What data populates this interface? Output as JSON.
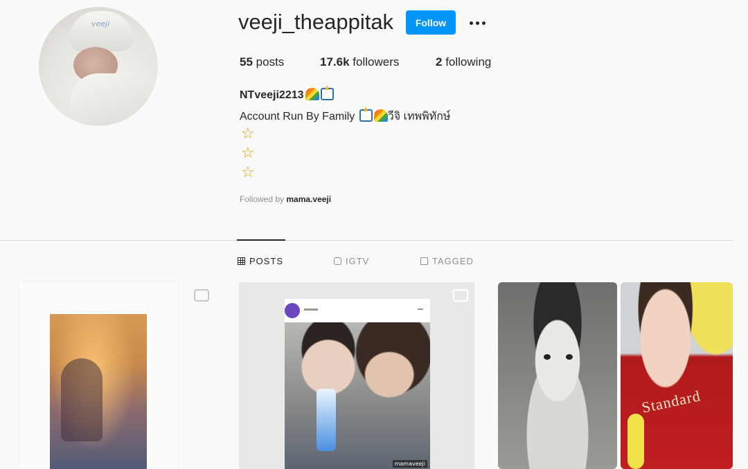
{
  "profile": {
    "username": "veeji_theappitak",
    "follow_label": "Follow",
    "avatar_label": "veeji",
    "stats": {
      "posts_count": "55",
      "posts_label": "posts",
      "followers_count": "17.6k",
      "followers_label": "followers",
      "following_count": "2",
      "following_label": "following"
    },
    "full_name": "NTveeji2213",
    "bio_prefix": "Account Run By Family",
    "bio_suffix": "วีจิ เทพพิทักษ์",
    "stars": [
      "☆",
      "☆",
      "☆"
    ],
    "followed_by_prefix": "Followed by",
    "followed_by_user": "mama.veeji"
  },
  "tabs": [
    {
      "label": "POSTS",
      "active": true,
      "icon": "grid-icon"
    },
    {
      "label": "IGTV",
      "active": false,
      "icon": "igtv-icon"
    },
    {
      "label": "TAGGED",
      "active": false,
      "icon": "tag-icon"
    }
  ],
  "posts": {
    "post_2_watermark": "mamaveeji",
    "post_4_shirt_text": "Standard"
  },
  "colors": {
    "follow_button": "#0095f6",
    "background": "#fafafa",
    "text": "#262626",
    "muted": "#8e8e8e"
  }
}
